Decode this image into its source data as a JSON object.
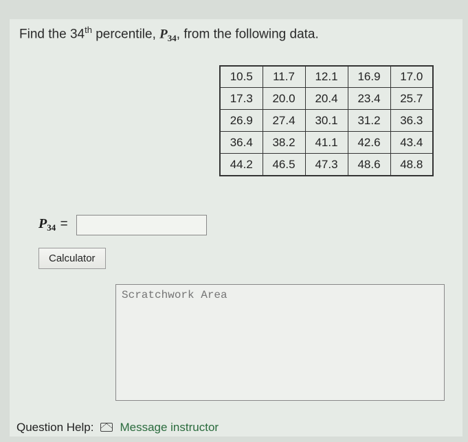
{
  "question": {
    "prefix": "Find the ",
    "ord": "34",
    "ord_sup": "th",
    "mid": " percentile, ",
    "sym": "P",
    "sub": "34",
    "suffix": ",  from the following data."
  },
  "data_rows": [
    [
      "10.5",
      "11.7",
      "12.1",
      "16.9",
      "17.0"
    ],
    [
      "17.3",
      "20.0",
      "20.4",
      "23.4",
      "25.7"
    ],
    [
      "26.9",
      "27.4",
      "30.1",
      "31.2",
      "36.3"
    ],
    [
      "36.4",
      "38.2",
      "41.1",
      "42.6",
      "43.4"
    ],
    [
      "44.2",
      "46.5",
      "47.3",
      "48.6",
      "48.8"
    ]
  ],
  "answer": {
    "sym": "P",
    "sub": "34",
    "eq": "=",
    "value": ""
  },
  "buttons": {
    "calculator": "Calculator"
  },
  "scratch": {
    "placeholder": "Scratchwork Area"
  },
  "help": {
    "label": "Question Help:",
    "link": "Message instructor"
  }
}
